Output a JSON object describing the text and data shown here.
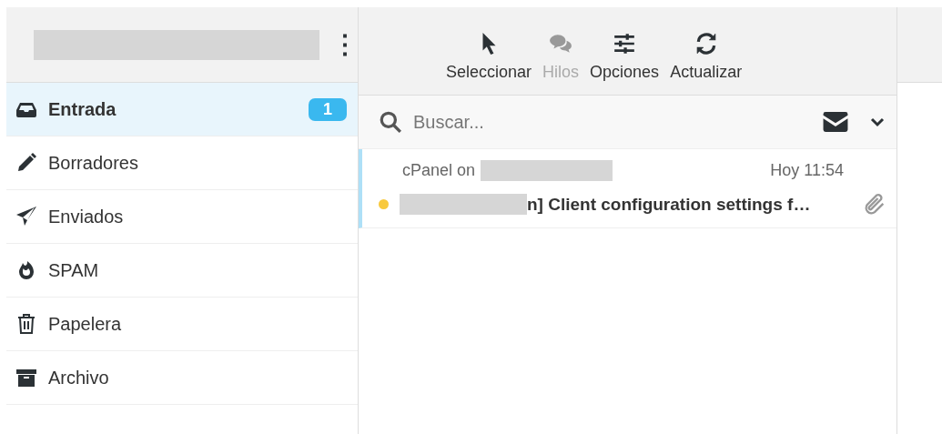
{
  "account": {
    "menu": "⋮"
  },
  "folders": [
    {
      "kind": "inbox",
      "label": "Entrada",
      "count": "1",
      "selected": true
    },
    {
      "kind": "drafts",
      "label": "Borradores",
      "selected": false
    },
    {
      "kind": "sent",
      "label": "Enviados",
      "selected": false
    },
    {
      "kind": "spam",
      "label": "SPAM",
      "selected": false
    },
    {
      "kind": "trash",
      "label": "Papelera",
      "selected": false
    },
    {
      "kind": "archive",
      "label": "Archivo",
      "selected": false
    }
  ],
  "toolbar": [
    {
      "kind": "select",
      "label": "Seleccionar",
      "disabled": false
    },
    {
      "kind": "threads",
      "label": "Hilos",
      "disabled": true
    },
    {
      "kind": "options",
      "label": "Opciones",
      "disabled": false
    },
    {
      "kind": "refresh",
      "label": "Actualizar",
      "disabled": false
    }
  ],
  "search": {
    "placeholder": "Buscar..."
  },
  "messages": [
    {
      "from": "cPanel on",
      "time": "Hoy 11:54",
      "subject": "n] Client configuration settings f…",
      "unread": true,
      "attachment": true,
      "selected": true
    }
  ]
}
